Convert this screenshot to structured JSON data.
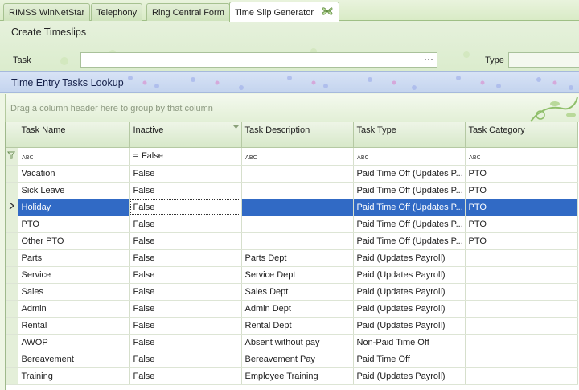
{
  "tabs": [
    {
      "label": "RIMSS WinNetStar",
      "active": false
    },
    {
      "label": "Telephony",
      "active": false
    },
    {
      "label": "Ring Central Form",
      "active": false
    },
    {
      "label": "Time Slip Generator",
      "active": true
    }
  ],
  "create_panel": {
    "title": "Create Timeslips",
    "task_label": "Task",
    "task_value": "",
    "task_button": "···",
    "type_label": "Type",
    "type_value": ""
  },
  "lookup": {
    "title": "Time Entry Tasks Lookup",
    "groupby_hint": "Drag a column header here to group by that column"
  },
  "grid": {
    "columns": [
      "Task Name",
      "Inactive",
      "Task Description",
      "Task Type",
      "Task Category"
    ],
    "filter": {
      "inactive": "False"
    },
    "rows": [
      {
        "name": "Vacation",
        "inactive": "False",
        "desc": "",
        "type": "Paid Time Off (Updates P...",
        "category": "PTO"
      },
      {
        "name": "Sick Leave",
        "inactive": "False",
        "desc": "",
        "type": "Paid Time Off (Updates P...",
        "category": "PTO"
      },
      {
        "name": "Holiday",
        "inactive": "False",
        "desc": "",
        "type": "Paid Time Off (Updates P...",
        "category": "PTO"
      },
      {
        "name": "PTO",
        "inactive": "False",
        "desc": "",
        "type": "Paid Time Off (Updates P...",
        "category": "PTO"
      },
      {
        "name": "Other PTO",
        "inactive": "False",
        "desc": "",
        "type": "Paid Time Off (Updates P...",
        "category": "PTO"
      },
      {
        "name": "Parts",
        "inactive": "False",
        "desc": "Parts Dept",
        "type": "Paid (Updates Payroll)",
        "category": ""
      },
      {
        "name": "Service",
        "inactive": "False",
        "desc": "Service Dept",
        "type": "Paid (Updates Payroll)",
        "category": ""
      },
      {
        "name": "Sales",
        "inactive": "False",
        "desc": "Sales Dept",
        "type": "Paid (Updates Payroll)",
        "category": ""
      },
      {
        "name": "Admin",
        "inactive": "False",
        "desc": "Admin Dept",
        "type": "Paid (Updates Payroll)",
        "category": ""
      },
      {
        "name": "Rental",
        "inactive": "False",
        "desc": "Rental Dept",
        "type": "Paid (Updates Payroll)",
        "category": ""
      },
      {
        "name": "AWOP",
        "inactive": "False",
        "desc": "Absent without pay",
        "type": "Non-Paid Time Off",
        "category": ""
      },
      {
        "name": "Bereavement",
        "inactive": "False",
        "desc": "Bereavement Pay",
        "type": "Paid Time Off",
        "category": ""
      },
      {
        "name": "Training",
        "inactive": "False",
        "desc": "Employee Training",
        "type": "Paid (Updates Payroll)",
        "category": ""
      }
    ]
  },
  "colors": {
    "selection": "#316ac5",
    "theme_green": "#dbeccd",
    "lookup_blue": "#c4d4ee"
  }
}
